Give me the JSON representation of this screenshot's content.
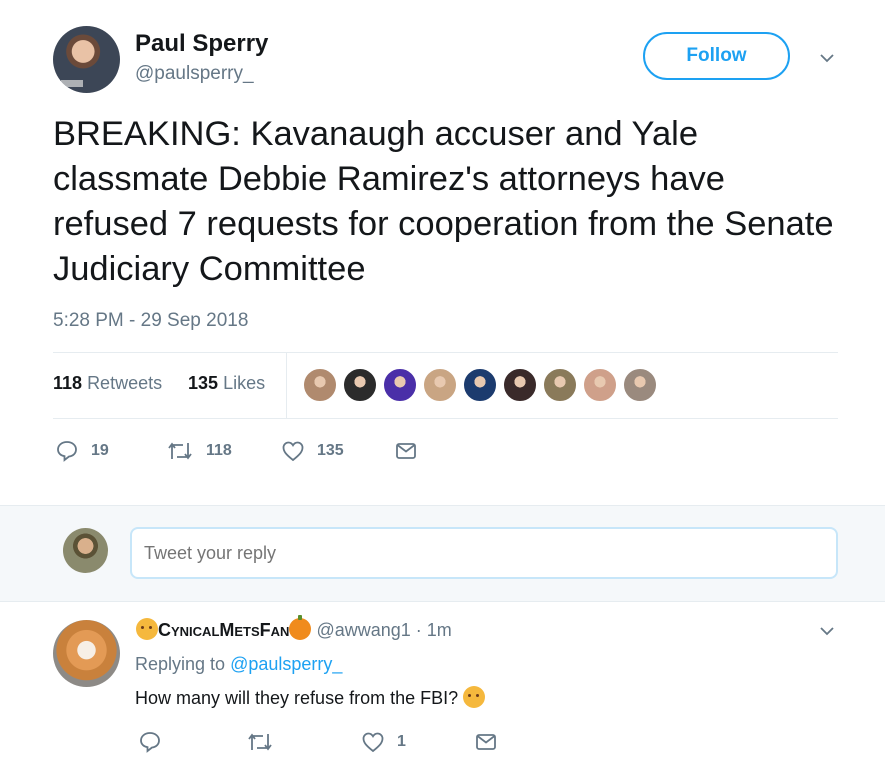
{
  "tweet": {
    "author_name": "Paul Sperry",
    "author_handle": "@paulsperry_",
    "follow_label": "Follow",
    "text": "BREAKING: Kavanaugh accuser and Yale classmate Debbie Ramirez's attorneys have refused 7 requests for cooperation from the Senate Judiciary Committee",
    "timestamp": "5:28 PM - 29 Sep 2018",
    "retweets_count": "118",
    "retweets_label": "Retweets",
    "likes_count": "135",
    "likes_label": "Likes",
    "liker_avatar_colors": [
      "#b08a6e",
      "#2b2b2b",
      "#4a2fa8",
      "#c9a583",
      "#1c3b6e",
      "#3a2a2a",
      "#8a7a5a",
      "#cfa08a",
      "#9a8a7e"
    ],
    "actions": {
      "reply_count": "19",
      "retweet_count": "118",
      "like_count": "135"
    }
  },
  "reply_box": {
    "placeholder": "Tweet your reply"
  },
  "reply": {
    "author_name": "CynicalMetsFan",
    "author_handle": "@awwang1",
    "time": "· 1m",
    "replying_prefix": "Replying to",
    "replying_to": "@paulsperry_",
    "text": "How many will they refuse from the FBI?",
    "like_count": "1"
  },
  "colors": {
    "accent": "#1da1f2",
    "secondary_text": "#657786",
    "border": "#e6ecf0"
  },
  "icons": [
    "chevron-down-icon",
    "reply-icon",
    "retweet-icon",
    "like-icon",
    "message-icon",
    "thinking-emoji-icon",
    "pumpkin-emoji-icon"
  ]
}
